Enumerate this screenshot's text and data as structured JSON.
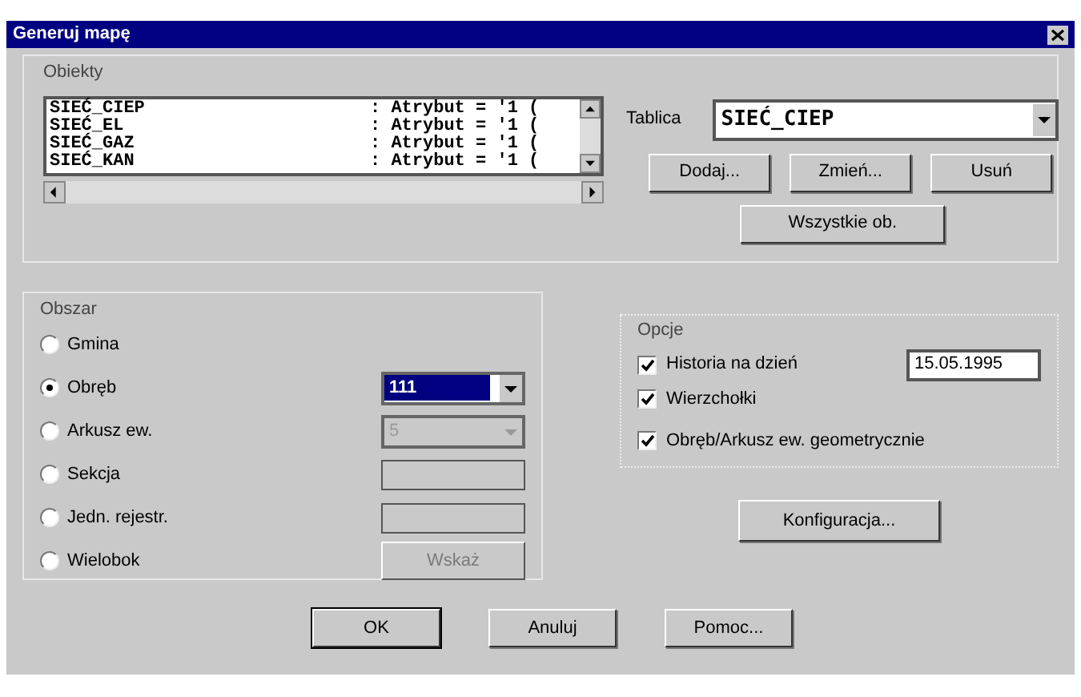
{
  "window": {
    "title": "Generuj mapę"
  },
  "objects": {
    "label": "Obiekty",
    "rows": [
      {
        "name": "SIEĆ_CIEP",
        "value": ": Atrybut = '1 ("
      },
      {
        "name": "SIEĆ_EL",
        "value": ": Atrybut = '1 ("
      },
      {
        "name": "SIEĆ_GAZ",
        "value": ": Atrybut = '1 ("
      },
      {
        "name": "SIEĆ_KAN",
        "value": ": Atrybut = '1 ("
      }
    ]
  },
  "table": {
    "label": "Tablica",
    "value": "SIEĆ_CIEP"
  },
  "object_buttons": [
    "Dodaj...",
    "Zmień...",
    "Usuń"
  ],
  "all_button": "Wszystkie ob.",
  "area": {
    "label": "Obszar",
    "options": [
      {
        "label": "Gmina",
        "selected": false,
        "kind": "none"
      },
      {
        "label": "Obręb",
        "selected": true,
        "kind": "combo",
        "value": "111",
        "disabled": false
      },
      {
        "label": "Arkusz ew.",
        "selected": false,
        "kind": "combo",
        "value": "5",
        "disabled": true
      },
      {
        "label": "Sekcja",
        "selected": false,
        "kind": "field"
      },
      {
        "label": "Jedn. rejestr.",
        "selected": false,
        "kind": "field"
      },
      {
        "label": "Wielobok",
        "selected": false,
        "kind": "button",
        "value": "Wskaż",
        "disabled": true
      }
    ]
  },
  "options": {
    "label": "Opcje",
    "items": [
      {
        "label": "Historia na dzień",
        "checked": true,
        "value": "15.05.1995"
      },
      {
        "label": "Wierzchołki",
        "checked": true
      },
      {
        "label": "Obręb/Arkusz ew. geometrycznie",
        "checked": true
      }
    ]
  },
  "config_button": "Konfiguracja...",
  "buttons": [
    "OK",
    "Anuluj",
    "Pomoc..."
  ]
}
